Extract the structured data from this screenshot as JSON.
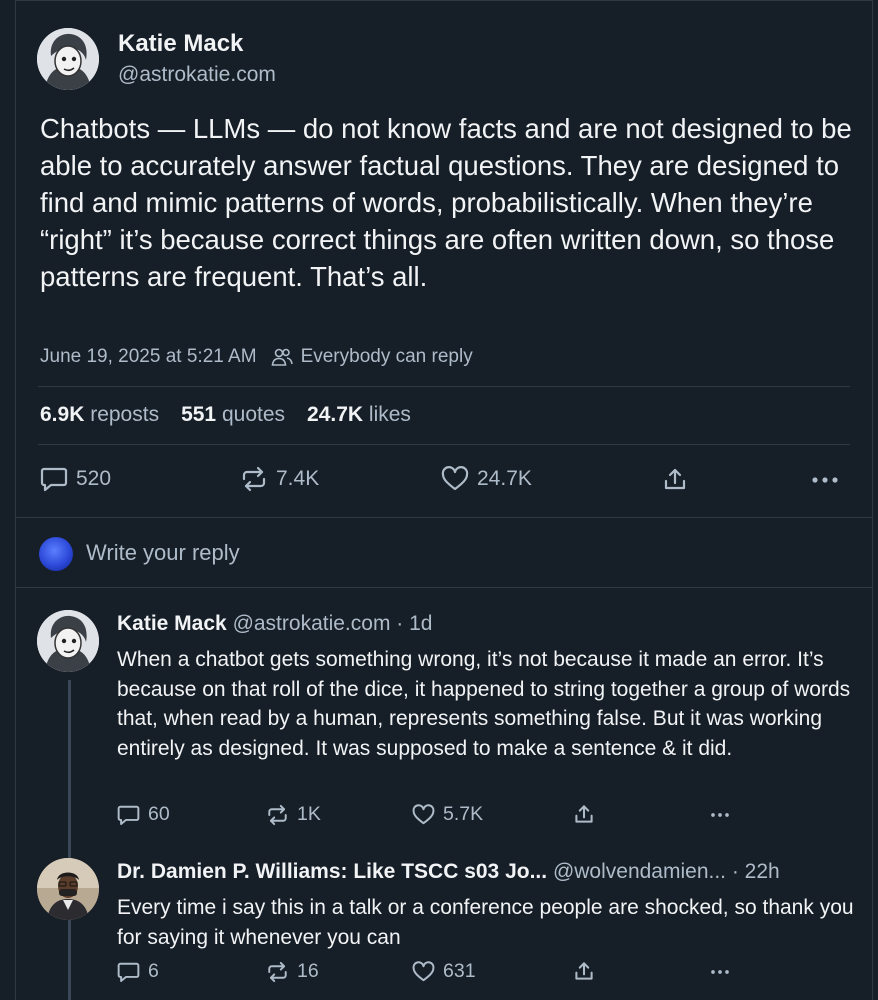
{
  "post": {
    "author_name": "Katie Mack",
    "author_handle": "@astrokatie.com",
    "text": "Chatbots — LLMs — do not know facts and are not designed to be able to accurately answer factual questions. They are designed to find and mimic patterns of words, probabilistically. When they’re “right” it’s because correct things are often written down, so those patterns are frequent. That’s all.",
    "timestamp": "June 19, 2025 at 5:21 AM",
    "reply_setting": "Everybody can reply",
    "stats": {
      "reposts_count": "6.9K",
      "reposts_label": "reposts",
      "quotes_count": "551",
      "quotes_label": "quotes",
      "likes_count": "24.7K",
      "likes_label": "likes"
    },
    "actions": {
      "replies": "520",
      "reposts": "7.4K",
      "likes": "24.7K"
    }
  },
  "reply_box": {
    "placeholder": "Write your reply"
  },
  "replies": [
    {
      "name": "Katie Mack",
      "handle": "@astrokatie.com",
      "time": "· 1d",
      "text": "When a chatbot gets something wrong, it’s not because it made an error. It’s because on that roll of the dice, it happened to string together a group of words that, when read by a human, represents something false. But it was working entirely as designed. It was supposed to make a sentence & it did.",
      "replies": "60",
      "reposts": "1K",
      "likes": "5.7K"
    },
    {
      "name": "Dr. Damien P. Williams: Like TSCC s03 Jo...",
      "handle": "@wolvendamien...",
      "time": "· 22h",
      "text": "Every time i say this in a talk or a conference people are shocked, so thank you for saying it whenever you can",
      "replies": "6",
      "reposts": "16",
      "likes": "631"
    }
  ],
  "icons": {
    "reply": "speech-bubble-icon",
    "repost": "repost-arrows-icon",
    "like": "heart-icon",
    "share": "share-upload-icon",
    "more": "ellipsis-icon",
    "reply_setting": "people-icon"
  },
  "colors": {
    "background": "#161e27",
    "text": "#f1f3f5",
    "muted": "#aebbc9",
    "divider": "#2e3945"
  }
}
